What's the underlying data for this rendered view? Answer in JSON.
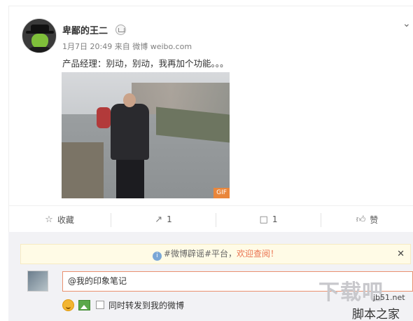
{
  "post": {
    "username": "卑鄙的王二",
    "date": "1月7日 20:49",
    "source_prefix": "来自",
    "source": "微博 weibo.com",
    "text": "产品经理：别动，别动，我再加个功能。。。",
    "media_badge": "GIF"
  },
  "actions": {
    "favorite_label": "收藏",
    "repost_count": "1",
    "comment_count": "1",
    "like_label": "赞"
  },
  "notice": {
    "topic": "#微博辟谣#平台，",
    "link": "欢迎查阅！"
  },
  "comment": {
    "input_value": "@我的印象笔记",
    "repost_label": "同时转发到我的微博"
  },
  "watermark": {
    "big": "下载吧",
    "site": "jb51.net",
    "name": "脚本之家"
  },
  "colors": {
    "accent": "#eb7350",
    "gif_badge": "#e9863b",
    "notice_bg": "#fffbe6"
  }
}
